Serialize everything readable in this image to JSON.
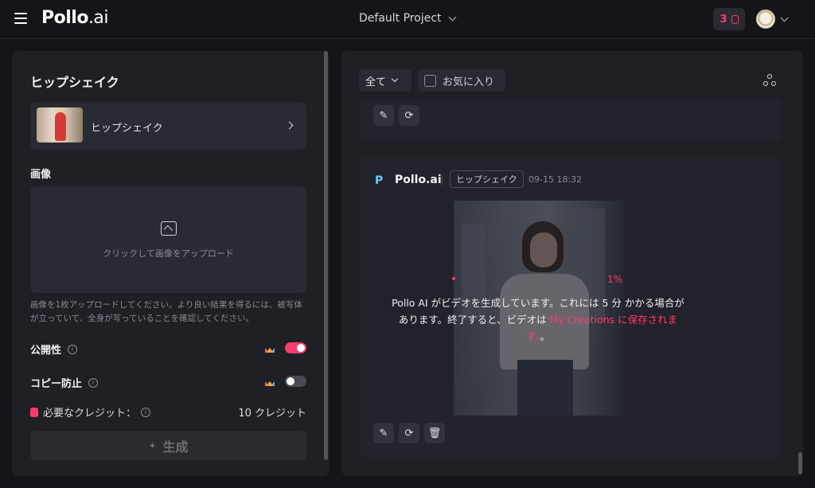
{
  "topbar": {
    "logo_main": "Pollo",
    "logo_suffix": ".ai",
    "project_name": "Default Project",
    "credits_count": "3"
  },
  "left_panel": {
    "title": "ヒップシェイク",
    "template_name": "ヒップシェイク",
    "image_section_label": "画像",
    "upload_text": "クリックして画像をアップロード",
    "upload_hint": "画像を1枚アップロードしてください。より良い結果を得るには、被写体が立っていて、全身が写っていることを確認してください。",
    "public_label": "公開性",
    "public_on": 1,
    "copy_protect_label": "コピー防止",
    "copy_protect_on": 0,
    "credits_label": "必要なクレジット：",
    "credits_value": "10 クレジット",
    "generate_label": "生成"
  },
  "right_panel": {
    "filter_value": "全て",
    "favorites_label": "お気に入り",
    "brand_name": "Pollo.ai",
    "task_tag": "ヒップシェイク",
    "timestamp": "09-15 18:32",
    "progress_text": "1%",
    "message_part1": "Pollo AI がビデオを生成しています。これには 5 分 かかる場合があります。終了すると、ビデオは ",
    "message_link": "My Creations に保存されます。",
    "message_part2": "。"
  },
  "colors": {
    "accent": "#ff3b6b",
    "panel": "#1f1f26",
    "background": "#141419"
  }
}
